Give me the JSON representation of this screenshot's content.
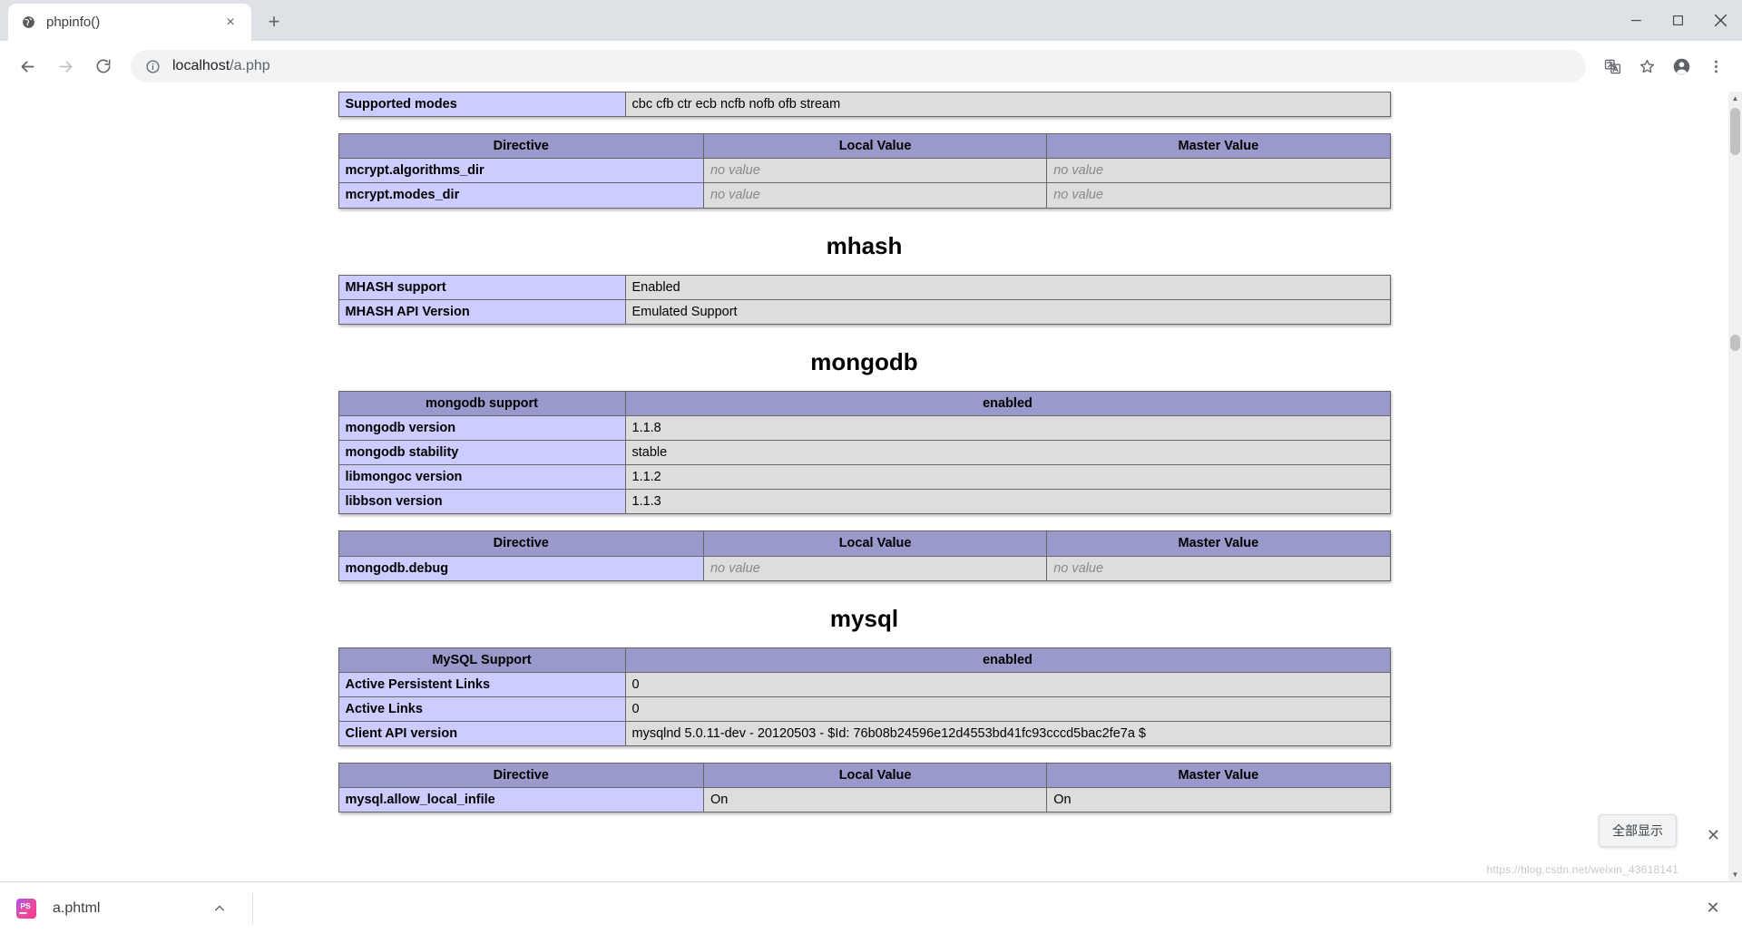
{
  "window": {
    "minimize_label": "Minimize",
    "maximize_label": "Maximize",
    "close_label": "Close"
  },
  "tabstrip": {
    "tabs": [
      {
        "title": "phpinfo()",
        "favicon": "globe-icon",
        "close_label": "×"
      }
    ],
    "new_tab_label": "+"
  },
  "toolbar": {
    "back_label": "←",
    "forward_label": "→",
    "reload_label": "↻",
    "url_host": "localhost",
    "url_path": "/a.php",
    "url_full": "localhost/a.php",
    "translate_icon": "translate-icon",
    "bookmark_icon": "star-icon",
    "profile_icon": "account-icon",
    "menu_icon": "three-dot-menu-icon"
  },
  "page": {
    "sections": [
      {
        "id": "mcrypt-supported-modes",
        "heading": null,
        "tables": [
          {
            "id": "mcrypt-modes-table",
            "header": null,
            "rows": [
              {
                "name": "Supported modes",
                "values": [
                  "cbc cfb ctr ecb ncfb nofb ofb stream"
                ],
                "span": "full"
              }
            ]
          },
          {
            "id": "mcrypt-directive-table",
            "header": [
              "Directive",
              "Local Value",
              "Master Value"
            ],
            "rows": [
              {
                "name": "mcrypt.algorithms_dir",
                "values": [
                  "no value",
                  "no value"
                ],
                "italic": [
                  true,
                  true
                ]
              },
              {
                "name": "mcrypt.modes_dir",
                "values": [
                  "no value",
                  "no value"
                ],
                "italic": [
                  true,
                  true
                ]
              }
            ]
          }
        ]
      },
      {
        "id": "mhash",
        "heading": "mhash",
        "tables": [
          {
            "id": "mhash-table",
            "header": null,
            "rows": [
              {
                "name": "MHASH support",
                "values": [
                  "Enabled"
                ],
                "span": "full"
              },
              {
                "name": "MHASH API Version",
                "values": [
                  "Emulated Support"
                ],
                "span": "full"
              }
            ]
          }
        ]
      },
      {
        "id": "mongodb",
        "heading": "mongodb",
        "tables": [
          {
            "id": "mongodb-support-table",
            "header": [
              "mongodb support",
              "enabled"
            ],
            "header_span": "two",
            "rows": [
              {
                "name": "mongodb version",
                "values": [
                  "1.1.8"
                ],
                "span": "full"
              },
              {
                "name": "mongodb stability",
                "values": [
                  "stable"
                ],
                "span": "full"
              },
              {
                "name": "libmongoc version",
                "values": [
                  "1.1.2"
                ],
                "span": "full"
              },
              {
                "name": "libbson version",
                "values": [
                  "1.1.3"
                ],
                "span": "full"
              }
            ]
          },
          {
            "id": "mongodb-directive-table",
            "header": [
              "Directive",
              "Local Value",
              "Master Value"
            ],
            "rows": [
              {
                "name": "mongodb.debug",
                "values": [
                  "no value",
                  "no value"
                ],
                "italic": [
                  true,
                  true
                ]
              }
            ]
          }
        ]
      },
      {
        "id": "mysql",
        "heading": "mysql",
        "tables": [
          {
            "id": "mysql-support-table",
            "header": [
              "MySQL Support",
              "enabled"
            ],
            "header_span": "two",
            "rows": [
              {
                "name": "Active Persistent Links",
                "values": [
                  "0"
                ],
                "span": "full"
              },
              {
                "name": "Active Links",
                "values": [
                  "0"
                ],
                "span": "full"
              },
              {
                "name": "Client API version",
                "values": [
                  "mysqlnd 5.0.11-dev - 20120503 - $Id: 76b08b24596e12d4553bd41fc93cccd5bac2fe7a $"
                ],
                "span": "full"
              }
            ]
          },
          {
            "id": "mysql-directive-table",
            "header": [
              "Directive",
              "Local Value",
              "Master Value"
            ],
            "rows": [
              {
                "name": "mysql.allow_local_infile",
                "values": [
                  "On",
                  "On"
                ],
                "italic": [
                  false,
                  false
                ]
              }
            ]
          }
        ]
      }
    ],
    "watermark": "https://blog.csdn.net/weixin_43618141"
  },
  "overlay": {
    "show_all_label": "全部显示",
    "close_label": "✕"
  },
  "download_shelf": {
    "file_name": "a.phtml",
    "file_icon": "phpstorm-icon",
    "chevron_label": "chevron-up-icon",
    "close_label": "✕"
  },
  "colors": {
    "table_header": "#9999cc",
    "row_name": "#ccccff",
    "row_value": "#dddddd",
    "border": "#666666",
    "chrome_frame": "#dee1e6"
  }
}
